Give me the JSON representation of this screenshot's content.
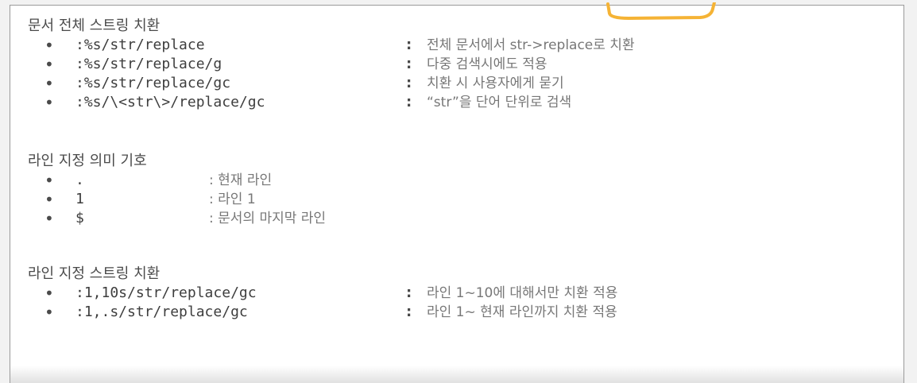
{
  "section1": {
    "heading": "문서 전체 스트링 치환",
    "items": [
      {
        "bullet": "•",
        "command": ":%s/str/replace",
        "colon": ":",
        "description": "전체 문서에서 str->replace로 치환"
      },
      {
        "bullet": "•",
        "command": ":%s/str/replace/g",
        "colon": ":",
        "description": "다중 검색시에도 적용"
      },
      {
        "bullet": "•",
        "command": ":%s/str/replace/gc",
        "colon": ":",
        "description": "치환 시 사용자에게 묻기"
      },
      {
        "bullet": "•",
        "command": ":%s/\\<str\\>/replace/gc",
        "colon": ":",
        "description": "“str”을 단어 단위로 검색"
      }
    ]
  },
  "section2": {
    "heading": "라인 지정 의미 기호",
    "items": [
      {
        "bullet": "•",
        "symbol": ".",
        "description": ": 현재 라인"
      },
      {
        "bullet": "•",
        "symbol": "1",
        "description": ": 라인 1"
      },
      {
        "bullet": "•",
        "symbol": "$",
        "description": ": 문서의 마지막 라인"
      }
    ]
  },
  "section3": {
    "heading": "라인 지정 스트링 치환",
    "items": [
      {
        "bullet": "•",
        "command": ":1,10s/str/replace/gc",
        "colon": ":",
        "description": "라인 1~10에 대해서만 치환 적용"
      },
      {
        "bullet": "•",
        "command": ":1,.s/str/replace/gc",
        "colon": ":",
        "description": "라인 1~ 현재 라인까지 치환 적용"
      }
    ]
  },
  "colors": {
    "heading": "#4a4a4a",
    "command": "#3e3e3e",
    "description": "#777777",
    "pen_mark": "#f5b335",
    "border": "#9a9a9a"
  }
}
